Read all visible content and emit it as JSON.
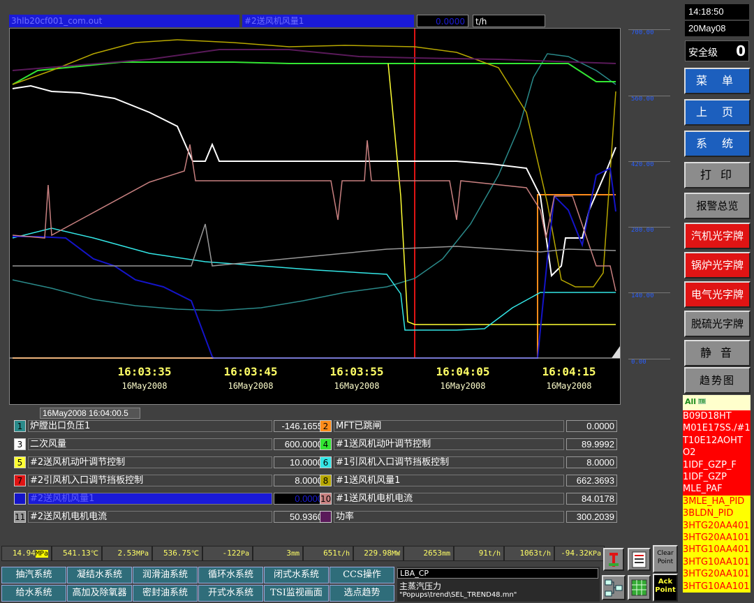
{
  "topbar": {
    "source_file": "3hlb20cf001_com.out",
    "selected_point": "#2送风机风量1",
    "selected_value": "0.0000",
    "selected_unit": "t/h"
  },
  "clock": {
    "time": "14:18:50",
    "date": "20May08",
    "safety_label": "安全级",
    "safety_level": "0"
  },
  "trend": {
    "y_ticks": [
      "700.00",
      "560.00",
      "420.00",
      "280.00",
      "140.00",
      "0.00"
    ],
    "x_times": [
      "16:03:35",
      "16:03:45",
      "16:03:55",
      "16:04:05",
      "16:04:15"
    ],
    "x_dates": [
      "16May2008",
      "16May2008",
      "16May2008",
      "16May2008",
      "16May2008"
    ],
    "cursor_time": "16May2008  16:04:00.5"
  },
  "legend": [
    {
      "num": "1",
      "name": "炉膛出口负压1",
      "value": "-146.1655",
      "color": "#2a8a8a"
    },
    {
      "num": "2",
      "name": "MFT已跳闸",
      "value": "0.0000",
      "color": "#ff8c1a"
    },
    {
      "num": "3",
      "name": "二次风量",
      "value": "600.0000",
      "color": "#ffffff"
    },
    {
      "num": "4",
      "name": "#1送风机动叶调节控制",
      "value": "89.9992",
      "color": "#33e633"
    },
    {
      "num": "5",
      "name": "#2送风机动叶调节控制",
      "value": "10.0000",
      "color": "#ffff33"
    },
    {
      "num": "6",
      "name": "#1引风机入口调节挡板控制",
      "value": "8.0000",
      "color": "#33e6e6"
    },
    {
      "num": "7",
      "name": "#2引风机入口调节挡板控制",
      "value": "8.0000",
      "color": "#e01414"
    },
    {
      "num": "8",
      "name": "#1送风机风量1",
      "value": "662.3693",
      "color": "#b8a800"
    },
    {
      "num": "9",
      "name": "#2送风机风量1",
      "value": "0.0000",
      "color": "#1414c8"
    },
    {
      "num": "10",
      "name": "#1送风机电机电流",
      "value": "84.0178",
      "color": "#c88080"
    },
    {
      "num": "11",
      "name": "#2送风机电机电流",
      "value": "50.9360",
      "color": "#999999"
    },
    {
      "num": "12",
      "name": "功率",
      "value": "300.2039",
      "color": "#5a1a5a"
    }
  ],
  "menu": {
    "btn_menu": "菜 单",
    "btn_prev": "上 页",
    "btn_system": "系 统",
    "btn_print": "打 印",
    "btn_alarm_overview": "报警总览",
    "btn_turbine_annun": "汽机光字牌",
    "btn_boiler_annun": "锅炉光字牌",
    "btn_electric_annun": "电气光字牌",
    "btn_desulf_annun": "脱硫光字牌",
    "btn_mute": "静 音",
    "btn_trend": "趋势图"
  },
  "alarm_header": {
    "all": "All",
    "tb": "TB"
  },
  "alarms": [
    {
      "text": "B09D18HT",
      "bg": "#ff0000"
    },
    {
      "text": "M01E17SS./#1",
      "bg": "#ff0000"
    },
    {
      "text": "T10E12AOHT",
      "bg": "#ff0000"
    },
    {
      "text": "O2",
      "bg": "#ff0000"
    },
    {
      "text": "1IDF_GZP_F",
      "bg": "#ff0000"
    },
    {
      "text": "1IDF_GZP",
      "bg": "#ff0000"
    },
    {
      "text": "MLE_PAF",
      "bg": "#ff0000"
    },
    {
      "text": "3MLE_HA_PID",
      "bg": "#ffff00"
    },
    {
      "text": "3BLDN_PID",
      "bg": "#ffff00"
    },
    {
      "text": "3HTG20AA401",
      "bg": "#ffff00"
    },
    {
      "text": "3HTG20AA101",
      "bg": "#ffff00"
    },
    {
      "text": "3HTG10AA401",
      "bg": "#ffff00"
    },
    {
      "text": "3HTG10AA101",
      "bg": "#ffff00"
    },
    {
      "text": "3HTG20AA101",
      "bg": "#ffff00"
    },
    {
      "text": "3HTG10AA101",
      "bg": "#ffff00"
    }
  ],
  "status": [
    {
      "value": "14.94",
      "unit": "MPa",
      "hl": true
    },
    {
      "value": "541.13",
      "unit": "℃"
    },
    {
      "value": "2.53",
      "unit": "MPa"
    },
    {
      "value": "536.75",
      "unit": "℃"
    },
    {
      "value": "-122",
      "unit": "Pa"
    },
    {
      "value": "3",
      "unit": "mm"
    },
    {
      "value": "651",
      "unit": "t/h"
    },
    {
      "value": "229.98",
      "unit": "MW"
    },
    {
      "value": "2653",
      "unit": "mm"
    },
    {
      "value": "91",
      "unit": "t/h"
    },
    {
      "value": "1063",
      "unit": "t/h"
    },
    {
      "value": "-94.32",
      "unit": "KPa"
    }
  ],
  "nav_row1": [
    "抽汽系统",
    "凝结水系统",
    "润滑油系统",
    "循环水系统",
    "闭式水系统",
    "CCS操作"
  ],
  "nav_row2": [
    "给水系统",
    "高加及除氧器",
    "密封油系统",
    "开式水系统",
    "TSI监视画面",
    "选点趋势"
  ],
  "info": {
    "tag": "LBA_CP",
    "desc": "主蒸汽压力",
    "path": "\"Popups\\trend\\SEL_TREND48.mn\""
  },
  "buttons": {
    "clear_point": "Clear\nPoint",
    "ack_point": "Ack\nPoint"
  }
}
